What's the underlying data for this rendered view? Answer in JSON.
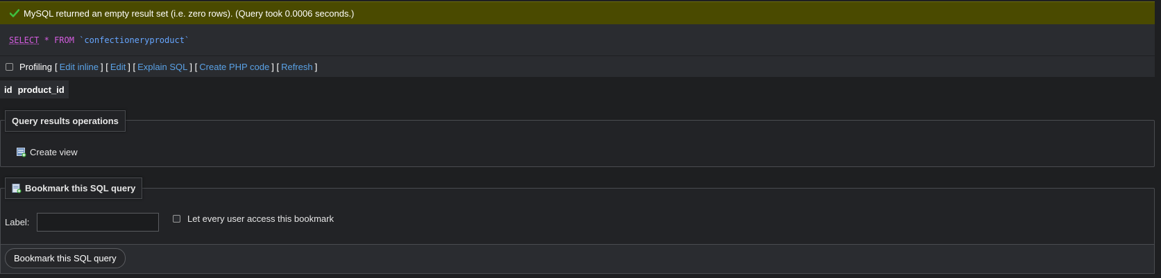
{
  "status": {
    "message": "MySQL returned an empty result set (i.e. zero rows). (Query took 0.0006 seconds.)",
    "icon": "check-icon",
    "color": "#4a4a00"
  },
  "sql": {
    "select": "SELECT",
    "star": "*",
    "from": "FROM",
    "table": "`confectioneryproduct`"
  },
  "toolbar": {
    "profiling_label": "Profiling",
    "links": [
      "Edit inline",
      "Edit",
      "Explain SQL",
      "Create PHP code",
      "Refresh"
    ],
    "open_bracket": "[",
    "close_bracket": "]"
  },
  "results": {
    "columns": [
      "id",
      "product_id"
    ]
  },
  "operations": {
    "legend": "Query results operations",
    "create_view": "Create view"
  },
  "bookmark": {
    "legend": "Bookmark this SQL query",
    "label_text": "Label:",
    "label_value": "",
    "share_text": "Let every user access this bookmark",
    "submit": "Bookmark this SQL query"
  },
  "colors": {
    "link": "#5aa2e6",
    "keyword": "#d55de0",
    "identifier": "#66a6ff"
  }
}
